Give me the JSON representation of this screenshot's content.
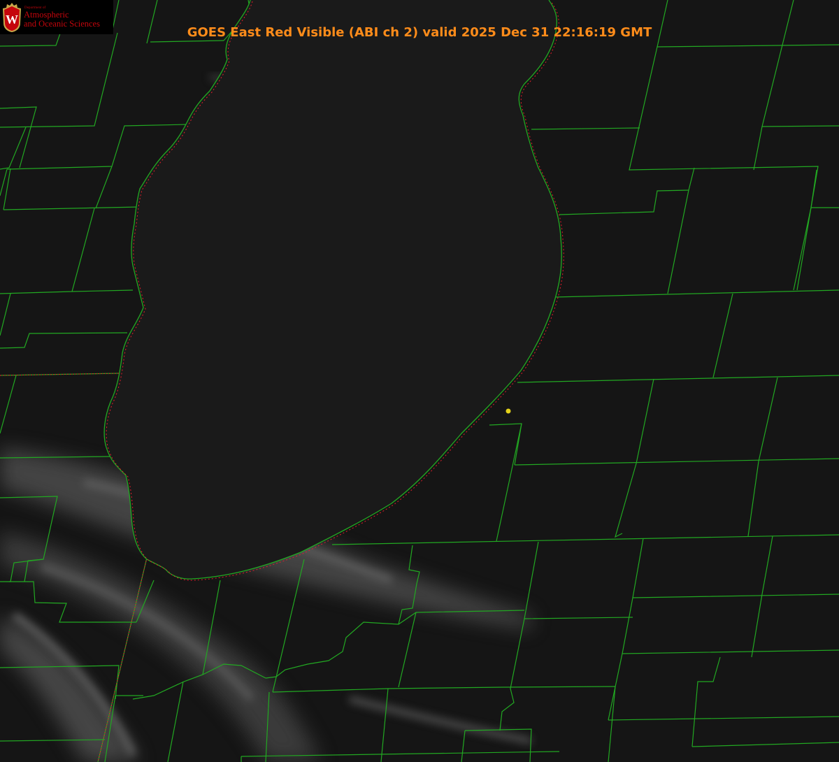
{
  "title": "GOES East Red Visible (ABI ch 2) valid 2025 Dec 31 22:16:19 GMT",
  "logo": {
    "department_line": "Department of",
    "name_line1": "Atmospheric",
    "name_line2": "and Oceanic Sciences",
    "seal_letter": "W"
  },
  "map": {
    "product": "visible satellite imagery",
    "feature": "lake",
    "overlays": [
      "county-boundaries",
      "state-boundaries",
      "shoreline",
      "station-marker"
    ]
  },
  "colors": {
    "title": "#ff8c1a",
    "county_lines": "#22a822",
    "shoreline_dotted": "#e0202a",
    "station_marker": "#e4d21a",
    "logo_text": "#c5050c",
    "lake_fill": "#1a1a1a",
    "land_fill": "#151515"
  },
  "icons": [
    "uw-crest-icon",
    "station-dot-icon"
  ]
}
